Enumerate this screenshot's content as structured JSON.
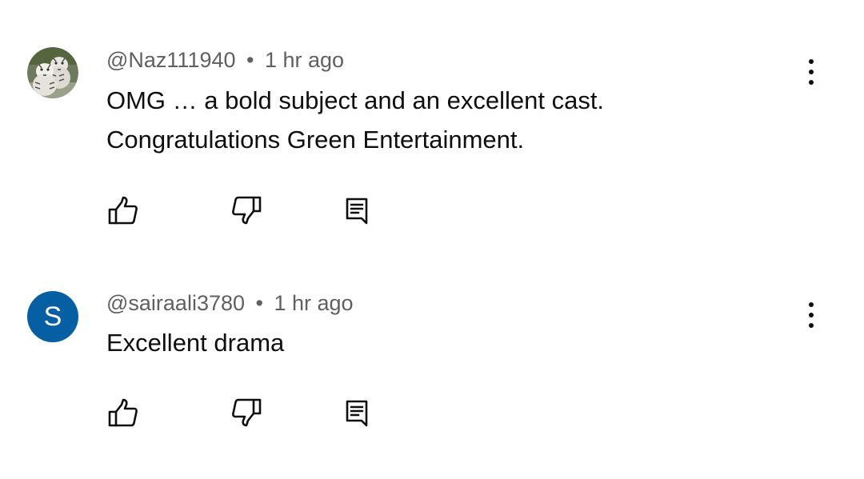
{
  "comments": [
    {
      "handle": "@Naz111940",
      "separator": "•",
      "time": "1 hr ago",
      "text": "OMG … a bold subject and an excellent cast.\nCongratulations Green Entertainment.",
      "avatar": {
        "type": "image",
        "description_icon": "white-tigers-avatar"
      },
      "icons": {
        "like": "thumb-up-icon",
        "dislike": "thumb-down-icon",
        "reply": "reply-icon",
        "more": "more-vert-icon"
      }
    },
    {
      "handle": "@sairaali3780",
      "separator": "•",
      "time": "1 hr ago",
      "text": "Excellent drama",
      "avatar": {
        "type": "letter",
        "letter": "S",
        "color": "#065fa3"
      },
      "icons": {
        "like": "thumb-up-icon",
        "dislike": "thumb-down-icon",
        "reply": "reply-icon",
        "more": "more-vert-icon"
      }
    }
  ],
  "colors": {
    "meta_text": "#606060",
    "body_text": "#0f0f0f",
    "background": "#ffffff"
  }
}
